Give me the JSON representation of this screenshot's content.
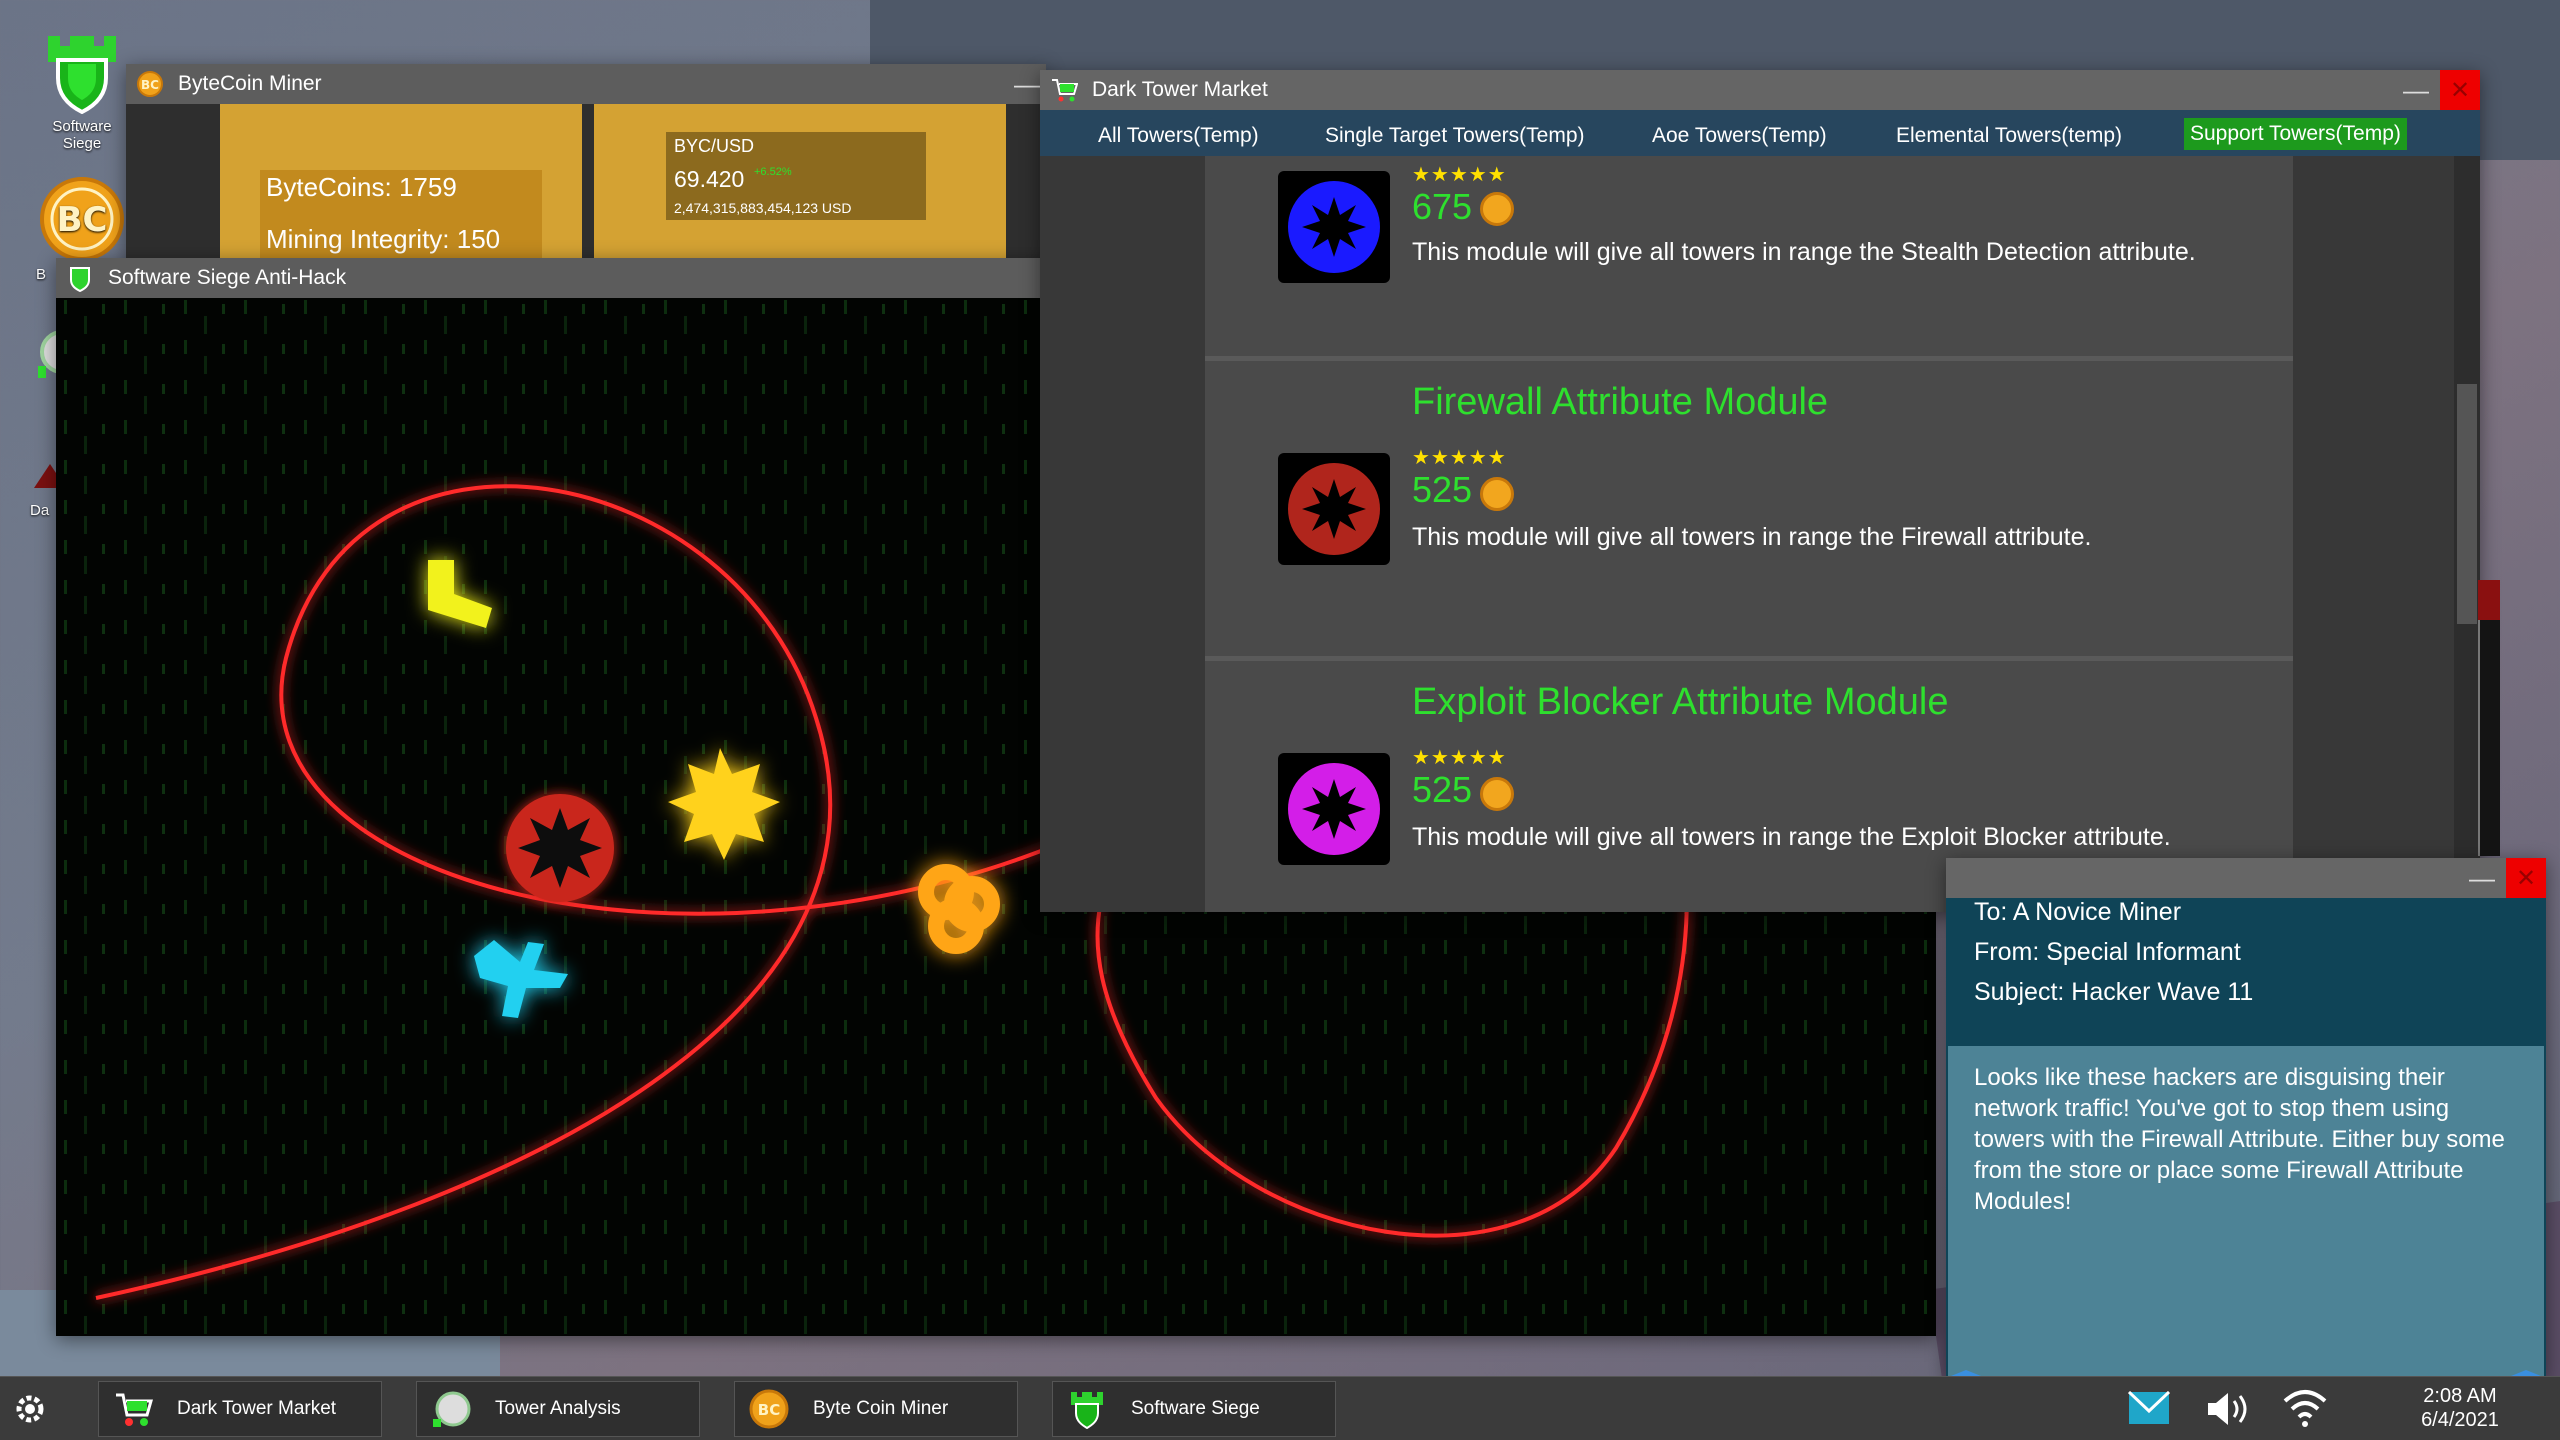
{
  "desktop": {
    "icons": [
      {
        "label": "Software\nSiege"
      },
      {
        "label": "B"
      },
      {
        "label": ""
      },
      {
        "label": "Da"
      }
    ]
  },
  "miner": {
    "title": "ByteCoin Miner",
    "bytecoins_label": "ByteCoins: 1759",
    "integrity_label": "Mining Integrity: 150",
    "pair": "BYC/USD",
    "price": "69.420",
    "change": "+6.52%",
    "market_cap": "2,474,315,883,454,123 USD"
  },
  "antihack": {
    "title": "Software Siege Anti-Hack"
  },
  "market": {
    "title": "Dark Tower Market",
    "tabs": [
      {
        "label": "All Towers(Temp)",
        "active": false
      },
      {
        "label": "Single Target Towers(Temp)",
        "active": false
      },
      {
        "label": "Aoe Towers(Temp)",
        "active": false
      },
      {
        "label": "Elemental Towers(temp)",
        "active": false
      },
      {
        "label": "Support Towers(Temp)",
        "active": true
      }
    ],
    "items": [
      {
        "title": "",
        "stars": "★★★★★",
        "price": "675",
        "desc": "This module will give all towers in range the Stealth Detection attribute.",
        "color": "#1a1aff"
      },
      {
        "title": "Firewall Attribute Module",
        "stars": "★★★★★",
        "price": "525",
        "desc": "This module will give all towers in range the Firewall attribute.",
        "color": "#b0251c"
      },
      {
        "title": "Exploit Blocker Attribute Module",
        "stars": "★★★★★",
        "price": "525",
        "desc": "This module will give all towers in range the Exploit Blocker attribute.",
        "color": "#d31ee8"
      }
    ]
  },
  "email": {
    "to": "To: A Novice Miner",
    "from": "From: Special Informant",
    "subject": "Subject: Hacker Wave 11",
    "body": "Looks like these hackers are disguising their network traffic! You've got to stop them using towers with the Firewall Attribute. Either buy some from the store or place some Firewall Attribute Modules!"
  },
  "taskbar": {
    "items": [
      {
        "label": "Dark Tower Market",
        "icon": "cart-icon"
      },
      {
        "label": "Tower Analysis",
        "icon": "analysis-icon"
      },
      {
        "label": "Byte Coin Miner",
        "icon": "bytecoin-icon"
      },
      {
        "label": "Software Siege",
        "icon": "castle-shield-icon"
      }
    ],
    "time": "2:08 AM",
    "date": "6/4/2021"
  },
  "colors": {
    "accent_green": "#2ee02e",
    "tab_bar": "#27465e",
    "gold": "#d4a233",
    "laser_red": "#ff2a2a"
  }
}
